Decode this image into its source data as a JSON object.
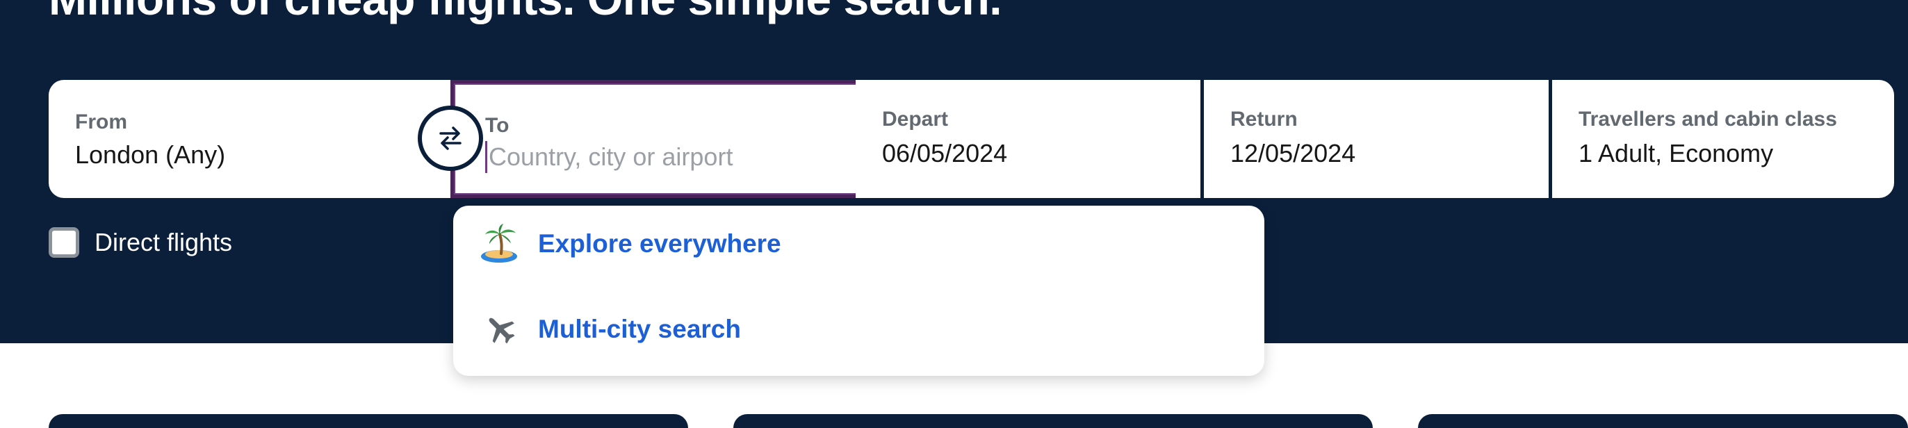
{
  "hero": {
    "headline": "Millions of cheap flights. One simple search."
  },
  "search": {
    "from": {
      "label": "From",
      "value": "London (Any)"
    },
    "to": {
      "label": "To",
      "value": "",
      "placeholder": "Country, city or airport"
    },
    "depart": {
      "label": "Depart",
      "value": "06/05/2024"
    },
    "return": {
      "label": "Return",
      "value": "12/05/2024"
    },
    "travellers": {
      "label": "Travellers and cabin class",
      "value": "1 Adult, Economy"
    },
    "swap_icon": "swap-arrows-icon"
  },
  "filters": {
    "direct_flights": {
      "label": "Direct flights",
      "checked": false
    }
  },
  "dropdown": {
    "items": [
      {
        "label": "Explore everywhere",
        "icon": "island-icon"
      },
      {
        "label": "Multi-city search",
        "icon": "plane-icon"
      }
    ]
  },
  "colors": {
    "hero_bg": "#0b1f3b",
    "accent_link": "#1c5fd6",
    "focus_border": "#4b235a"
  }
}
